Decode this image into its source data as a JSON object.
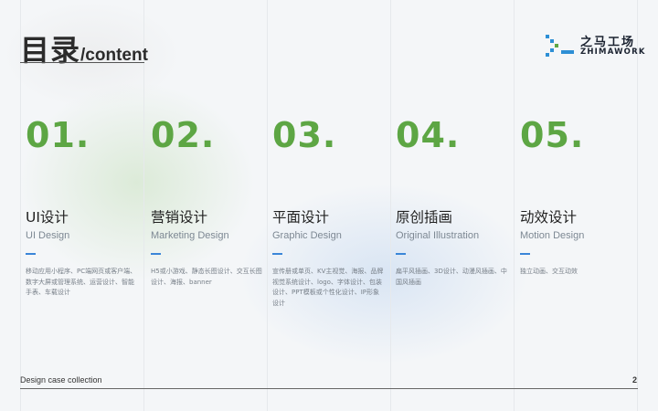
{
  "header": {
    "title_main": "目录",
    "title_sub": "/content"
  },
  "logo": {
    "name_cn": "之马工场",
    "name_en": "ZHIMAWORK",
    "colors": {
      "blue": "#2d8fd5",
      "green": "#5da644",
      "dark": "#1a2230"
    }
  },
  "sections": [
    {
      "number": "01.",
      "title_cn": "UI设计",
      "title_en": "UI Design",
      "description": "移动应用小程序、PC端网页或客户端、数字大屏或管理系统、运营设计、智能手表、车载设计"
    },
    {
      "number": "02.",
      "title_cn": "营销设计",
      "title_en": "Marketing Design",
      "description": "H5或小游戏、静态长图设计、交互长图设计、海报、banner"
    },
    {
      "number": "03.",
      "title_cn": "平面设计",
      "title_en": "Graphic Design",
      "description": "宣传册或单页、KV主视觉、海报、品牌视觉系统设计、logo、字体设计、包装设计、PPT模板或个性化设计、IP形象设计"
    },
    {
      "number": "04.",
      "title_cn": "原创插画",
      "title_en": "Original Illustration",
      "description": "扁平风插画、3D设计、动漫风插画、中国风插画"
    },
    {
      "number": "05.",
      "title_cn": "动效设计",
      "title_en": "Motion Design",
      "description": "独立动画、交互动效"
    }
  ],
  "footer": {
    "text": "Design case collection",
    "page_number": "2"
  },
  "colors": {
    "accent_green": "#5da644",
    "accent_blue": "#3b86d8",
    "background": "#f4f6f8"
  }
}
